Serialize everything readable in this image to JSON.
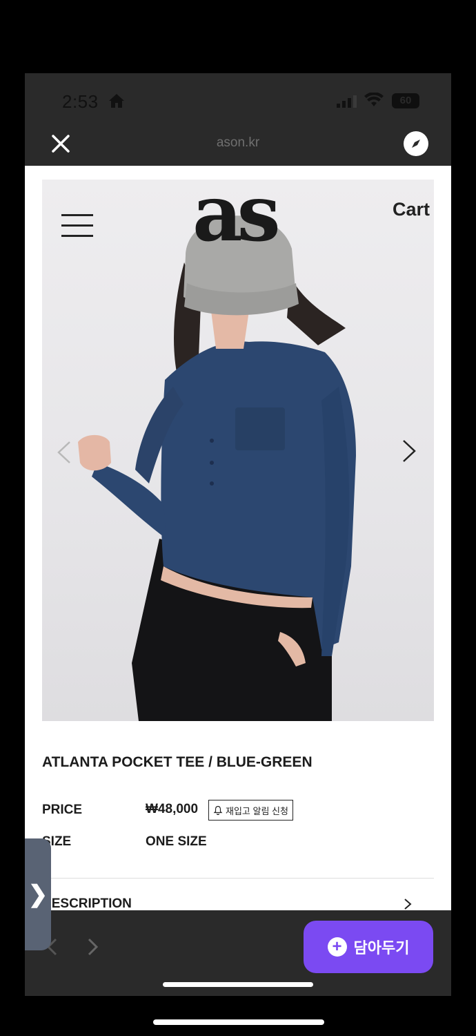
{
  "status": {
    "time": "2:53",
    "battery": "60"
  },
  "browser": {
    "url": "ason.kr"
  },
  "header": {
    "logo": "as",
    "cart_label": "Cart"
  },
  "product": {
    "title": "ATLANTA POCKET TEE / BLUE-GREEN",
    "price_label": "PRICE",
    "price": "₩48,000",
    "restock_label": "재입고 알림 신청",
    "size_label": "SIZE",
    "size_value": "ONE SIZE",
    "description_label": "DESCRIPTION"
  },
  "actions": {
    "add_label": "담아두기"
  },
  "colors": {
    "accent": "#7b4af2",
    "shirt": "#2c4770",
    "pants": "#141416",
    "cap": "#a9a9a7"
  }
}
